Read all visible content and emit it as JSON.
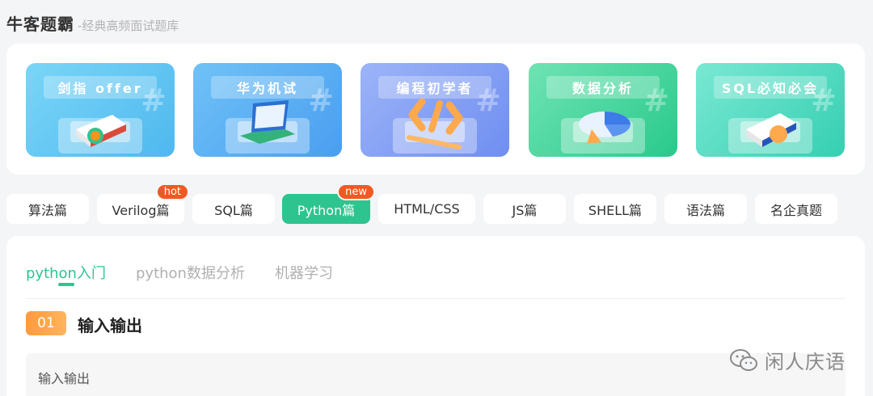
{
  "header": {
    "brand": "牛客题霸",
    "tagline": "-经典高频面试题库"
  },
  "banners": [
    {
      "label": "剑指 offer",
      "icon": "book-icon"
    },
    {
      "label": "华为机试",
      "icon": "laptop-test-icon"
    },
    {
      "label": "编程初学者",
      "icon": "code-brackets-icon"
    },
    {
      "label": "数据分析",
      "icon": "pie-chart-icon"
    },
    {
      "label": "SQL必知必会",
      "icon": "sql-book-icon"
    }
  ],
  "categories": [
    {
      "label": "算法篇"
    },
    {
      "label": "Verilog篇",
      "badge": "hot"
    },
    {
      "label": "SQL篇"
    },
    {
      "label": "Python篇",
      "badge": "new",
      "active": true
    },
    {
      "label": "HTML/CSS"
    },
    {
      "label": "JS篇"
    },
    {
      "label": "SHELL篇"
    },
    {
      "label": "语法篇"
    },
    {
      "label": "名企真题"
    }
  ],
  "subtabs": [
    {
      "label": "python入门",
      "active": true
    },
    {
      "label": "python数据分析"
    },
    {
      "label": "机器学习"
    }
  ],
  "section": {
    "number": "01",
    "title": "输入输出",
    "items": [
      "输入输出"
    ]
  },
  "watermark": {
    "text": "闲人庆语",
    "icon": "wechat-icon"
  },
  "colors": {
    "accent": "#2ec48f",
    "badge": "#f05a22",
    "number_badge": "#ff9a3c"
  }
}
